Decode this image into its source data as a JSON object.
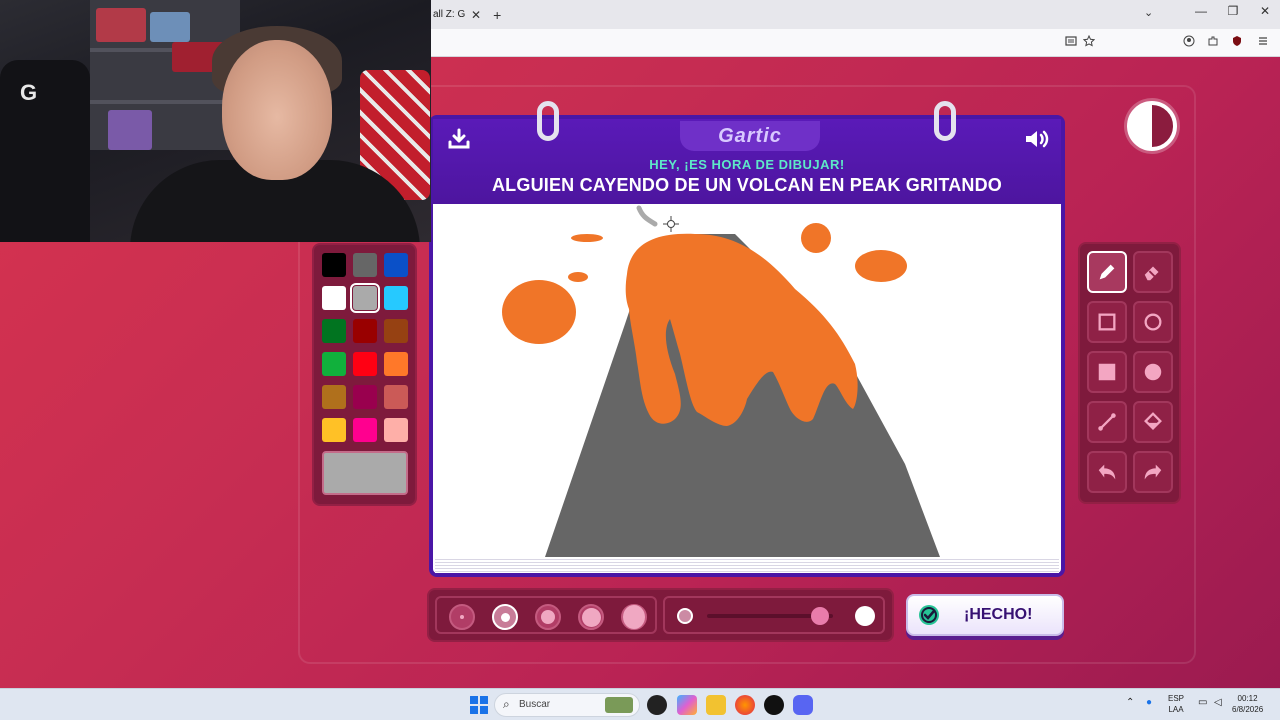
{
  "browser": {
    "tab_title": "all Z: Gol",
    "tab_close": "✕",
    "new_tab": "+",
    "tab_list": "⌄",
    "window": {
      "minimize": "—",
      "maximize": "❐",
      "close": "✕"
    }
  },
  "webcam": {
    "chair_logo": "G"
  },
  "game": {
    "logo": "Gartic",
    "subtitle": "HEY, ¡ES HORA DE DIBUJAR!",
    "prompt": "ALGUIEN CAYENDO DE UN VOLCAN EN PEAK GRITANDO",
    "done_label": "¡HECHO!"
  },
  "palette": {
    "colors": [
      "#000000",
      "#666666",
      "#0a50c8",
      "#ffffff",
      "#aaaaaa",
      "#26c9ff",
      "#017420",
      "#990000",
      "#964112",
      "#11b03c",
      "#ff0013",
      "#ff7829",
      "#b0701c",
      "#99004e",
      "#cb5a57",
      "#ffc126",
      "#ff008f",
      "#feafa8"
    ],
    "selected_color": "#aaaaaa",
    "current_color": "#aaaaaa"
  },
  "tools": {
    "items": [
      "pencil",
      "eraser",
      "rectangle-outline",
      "ellipse-outline",
      "rectangle-fill",
      "ellipse-fill",
      "line",
      "fill-bucket",
      "undo",
      "redo"
    ],
    "active": "pencil"
  },
  "brush": {
    "sizes": [
      "1",
      "2",
      "3",
      "4",
      "5"
    ],
    "selected_size": "2",
    "opacity": 0.9
  },
  "taskbar": {
    "search_placeholder": "Buscar",
    "lang_top": "ESP",
    "lang_bottom": "LAA",
    "time": "00:12",
    "date": "6/8/2026"
  }
}
